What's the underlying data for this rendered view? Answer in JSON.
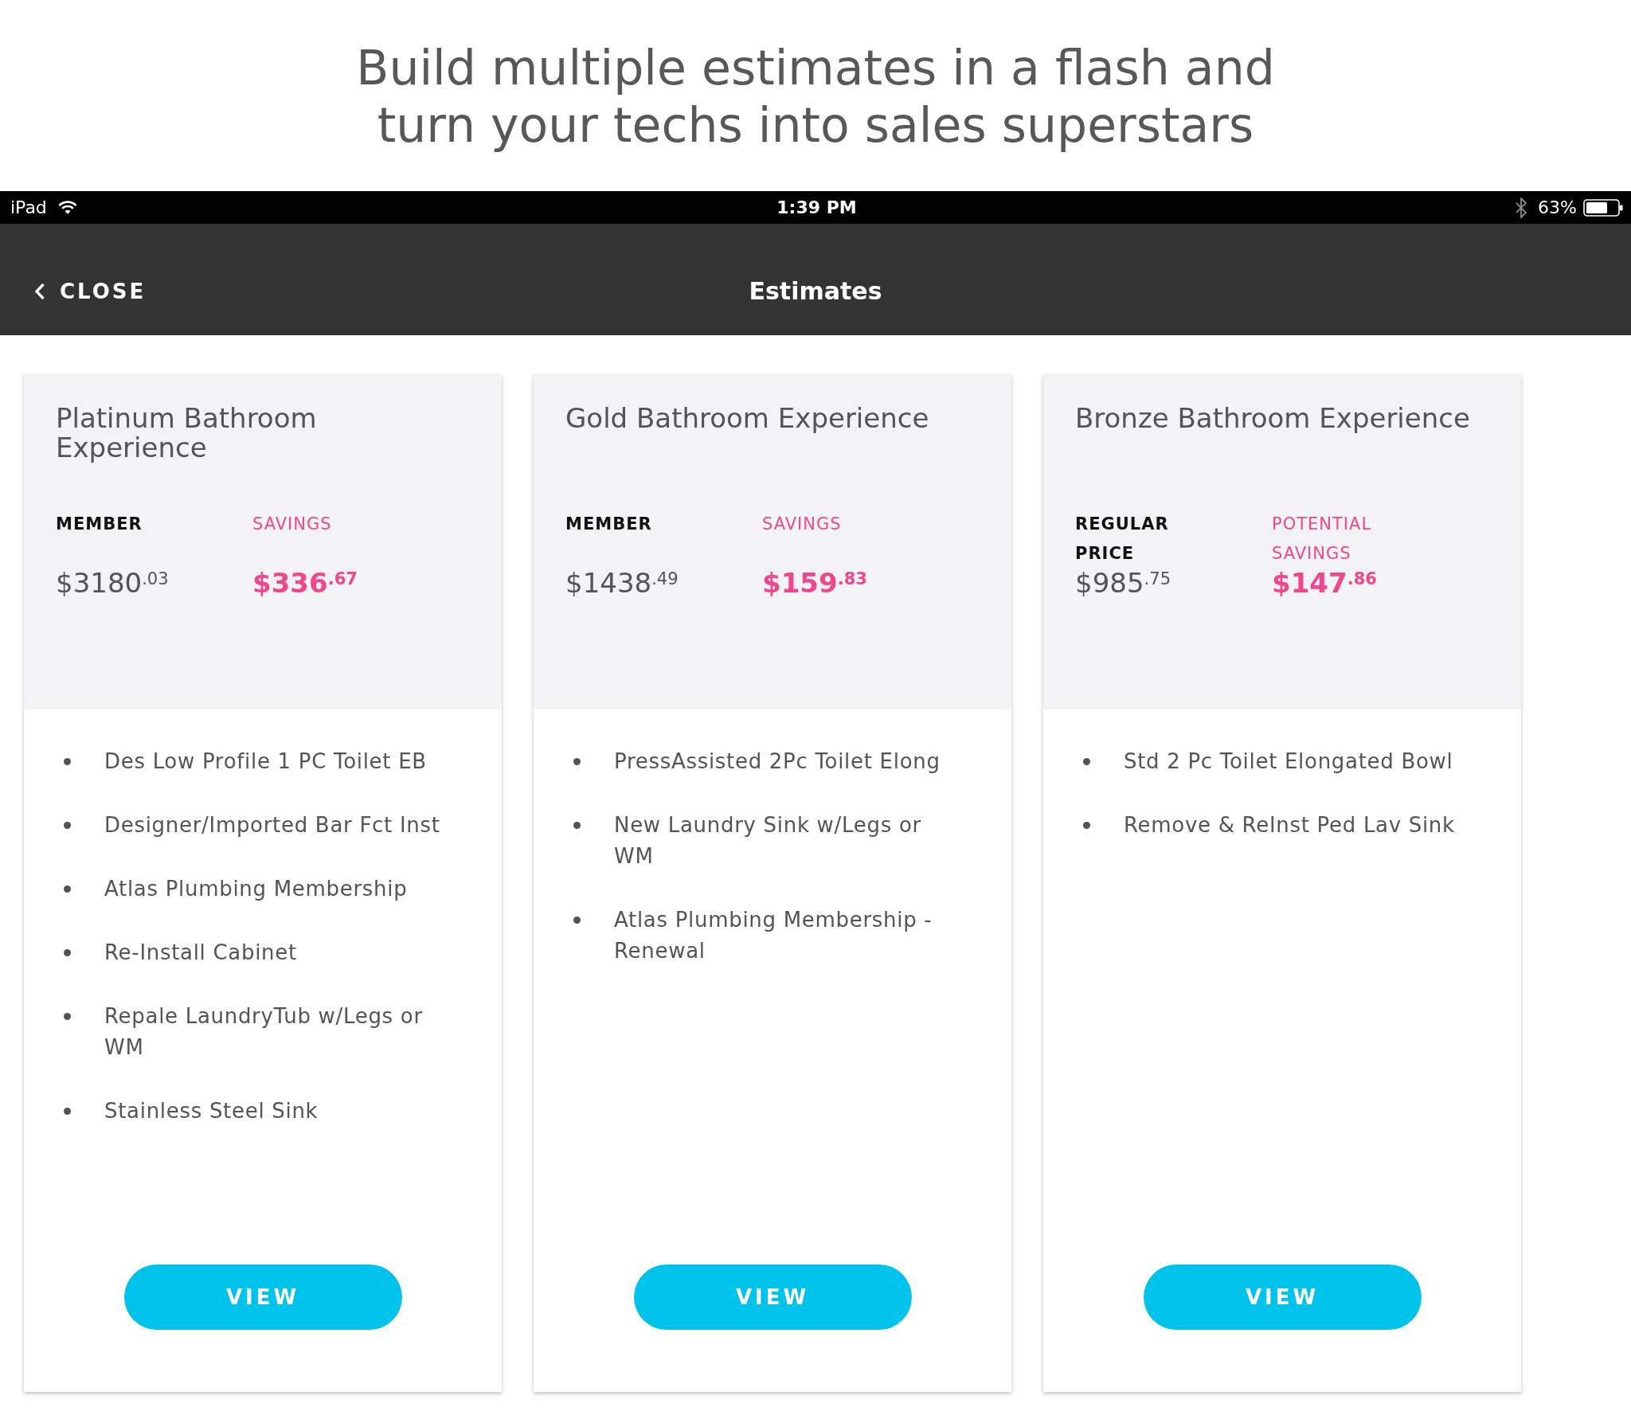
{
  "headline": "Build multiple estimates in a flash and turn your techs into sales superstars",
  "status_bar": {
    "device": "iPad",
    "time": "1:39 PM",
    "battery": "63%"
  },
  "nav": {
    "back": "CLOSE",
    "title": "Estimates"
  },
  "cards": [
    {
      "title": "Platinum Bathroom Experience",
      "prices": [
        {
          "kind": "price",
          "label": "MEMBER",
          "amount": "$3180$^{.03}$"
        },
        {
          "kind": "savings",
          "label": "SAVINGS",
          "amount": "$336$^{.67}$"
        }
      ],
      "items": [
        "Des Low Profile 1 PC Toilet EB",
        "Designer/Imported Bar Fct Inst",
        "Atlas Plumbing Membership",
        "Re-Install Cabinet",
        "Repale LaundryTub w/Legs or WM",
        "Stainless Steel Sink"
      ],
      "button": "VIEW"
    },
    {
      "title": "Gold Bathroom Experience",
      "prices": [
        {
          "kind": "price",
          "label": "MEMBER",
          "amount": "$1438$^{.49}$"
        },
        {
          "kind": "savings",
          "label": "SAVINGS",
          "amount": "$159$^{.83}$"
        }
      ],
      "items": [
        "PressAssisted 2Pc Toilet Elong",
        "New Laundry Sink w/Legs or WM",
        "Atlas Plumbing Membership - Renewal"
      ],
      "button": "VIEW"
    },
    {
      "title": "Bronze Bathroom Experience",
      "prices": [
        {
          "kind": "price",
          "label": "REGULAR PRICE",
          "amount": "$985$^{.75}$"
        },
        {
          "kind": "savings",
          "label": "POTENTIAL SAVINGS",
          "amount": "$147$^{.86}$"
        }
      ],
      "items": [
        "Std 2 Pc Toilet Elongated Bowl",
        "Remove & ReInst Ped Lav Sink"
      ],
      "button": "VIEW"
    }
  ]
}
